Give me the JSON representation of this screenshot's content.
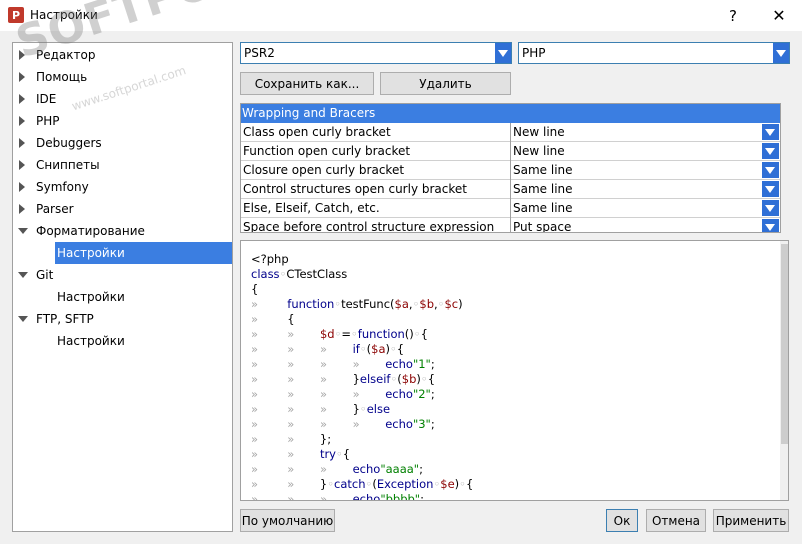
{
  "window": {
    "title": "Настройки",
    "help": "?",
    "close": "✕",
    "icon_letter": "P"
  },
  "watermark": {
    "main": "SOFTPORTAL",
    "sub": "www.softportal.com"
  },
  "tree": [
    {
      "label": "Редактор",
      "state": "collapsed"
    },
    {
      "label": "Помощь",
      "state": "collapsed"
    },
    {
      "label": "IDE",
      "state": "collapsed"
    },
    {
      "label": "PHP",
      "state": "collapsed"
    },
    {
      "label": "Debuggers",
      "state": "collapsed"
    },
    {
      "label": "Сниппеты",
      "state": "collapsed"
    },
    {
      "label": "Symfony",
      "state": "collapsed"
    },
    {
      "label": "Parser",
      "state": "collapsed"
    },
    {
      "label": "Форматирование",
      "state": "expanded"
    },
    {
      "label": "Настройки",
      "state": "child-selected"
    },
    {
      "label": "Git",
      "state": "expanded"
    },
    {
      "label": "Настройки",
      "state": "child"
    },
    {
      "label": "FTP, SFTP",
      "state": "expanded"
    },
    {
      "label": "Настройки",
      "state": "child"
    }
  ],
  "profile": {
    "style_value": "PSR2",
    "lang_value": "PHP"
  },
  "buttons": {
    "save_as": "Сохранить как...",
    "delete": "Удалить",
    "defaults": "По умолчанию",
    "ok": "Ок",
    "cancel": "Отмена",
    "apply": "Применить"
  },
  "properties": {
    "group": "Wrapping and Bracers",
    "rows": [
      {
        "name": "Class open curly bracket",
        "value": "New line"
      },
      {
        "name": "Function open curly bracket",
        "value": "New line"
      },
      {
        "name": "Closure open curly bracket",
        "value": "Same line"
      },
      {
        "name": "Control structures open curly bracket",
        "value": "Same line"
      },
      {
        "name": "Else, Elseif, Catch, etc.",
        "value": "Same line"
      },
      {
        "name": "Space before control structure expression",
        "value": "Put space"
      }
    ]
  },
  "code_lines": [
    "<?php",
    "class CTestClass",
    "{",
    "function testFunc($a, $b, $c)",
    "{",
    "$d = function() {",
    "if ($a) {",
    "echo \"1\";",
    "}elseif ($b) {",
    "echo \"2\";",
    "} else",
    "echo \"3\";",
    "};",
    "try {",
    "echo \"aaaa\";",
    "} catch (Exception $e) {",
    "echo \"bbbb\";"
  ],
  "colors": {
    "selection": "#3b7ee1",
    "dropdown": "#2f6fd6",
    "keyword": "#00008b",
    "variable": "#8b0000",
    "string": "#008000"
  }
}
